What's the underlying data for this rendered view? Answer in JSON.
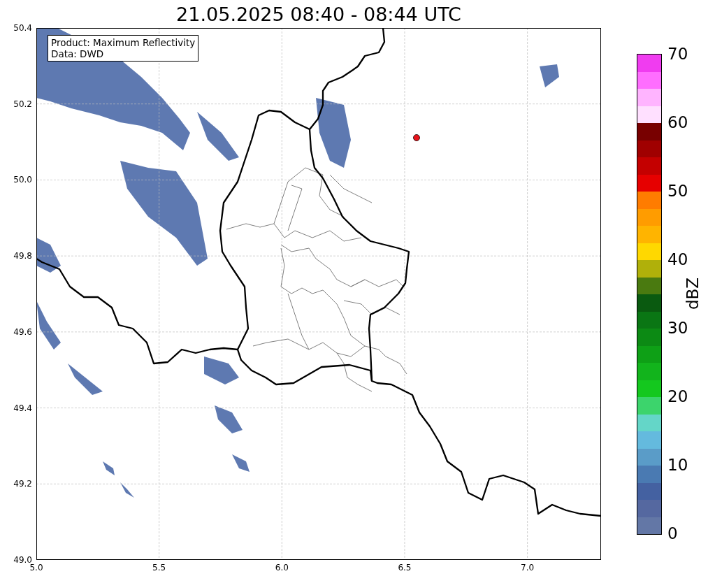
{
  "title": "21.05.2025 08:40 - 08:44 UTC",
  "map": {
    "info_lines": [
      "Product: Maximum Reflectivity",
      "Data: DWD"
    ],
    "xticks": [
      "5.0",
      "5.5",
      "6.0",
      "6.5",
      "7.0"
    ],
    "yticks": [
      "50.4",
      "50.2",
      "50.0",
      "49.8",
      "49.6",
      "49.4",
      "49.2",
      "49.0"
    ]
  },
  "colorbar": {
    "label": "dBZ",
    "ticks": [
      "70",
      "60",
      "50",
      "40",
      "30",
      "20",
      "10",
      "0"
    ],
    "bins": [
      {
        "color": "#f03cf0"
      },
      {
        "color": "#ff6eff"
      },
      {
        "color": "#ffb4ff"
      },
      {
        "color": "#ffe0ff"
      },
      {
        "color": "#780000"
      },
      {
        "color": "#a00000"
      },
      {
        "color": "#c40000"
      },
      {
        "color": "#e60000"
      },
      {
        "color": "#ff7c00"
      },
      {
        "color": "#ff9c00"
      },
      {
        "color": "#ffb400"
      },
      {
        "color": "#ffd800"
      },
      {
        "color": "#b0b00a"
      },
      {
        "color": "#4a7a10"
      },
      {
        "color": "#0a5a10"
      },
      {
        "color": "#0a7614"
      },
      {
        "color": "#0c8a14"
      },
      {
        "color": "#0ea016"
      },
      {
        "color": "#12b41c"
      },
      {
        "color": "#14c81e"
      },
      {
        "color": "#3cd46c"
      },
      {
        "color": "#64d6c8"
      },
      {
        "color": "#64bade"
      },
      {
        "color": "#5a9cc8"
      },
      {
        "color": "#4a7ab2"
      },
      {
        "color": "#4461a1"
      },
      {
        "color": "#5568a0"
      },
      {
        "color": "#6377a6"
      }
    ]
  }
}
